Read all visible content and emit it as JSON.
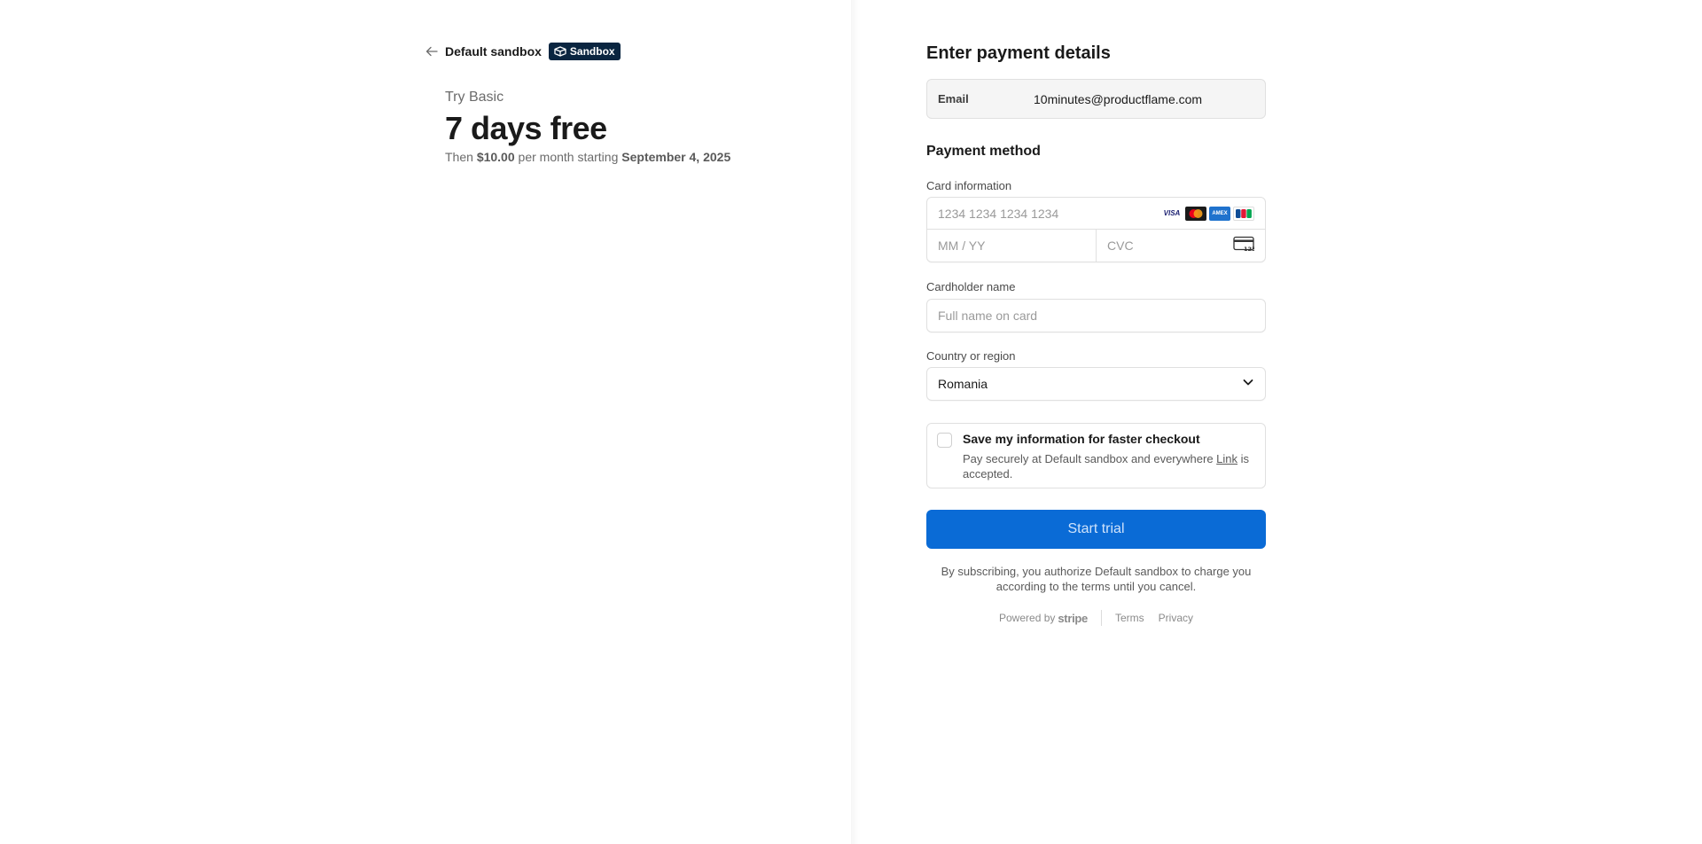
{
  "merchant": {
    "name": "Default sandbox",
    "badge": "Sandbox"
  },
  "product": {
    "name": "Try Basic",
    "trial_title": "7 days free",
    "then_prefix": "Then ",
    "price": "$10.00",
    "per": " per month starting ",
    "start_date": "September 4, 2025"
  },
  "payment": {
    "title": "Enter payment details",
    "email_label": "Email",
    "email_value": "10minutes@productflame.com",
    "method_title": "Payment method",
    "card_label": "Card information",
    "card_number_placeholder": "1234 1234 1234 1234",
    "expiry_placeholder": "MM / YY",
    "cvc_placeholder": "CVC",
    "cardholder_label": "Cardholder name",
    "cardholder_placeholder": "Full name on card",
    "country_label": "Country or region",
    "country_value": "Romania",
    "save_title": "Save my information for faster checkout",
    "save_desc_before": "Pay securely at Default sandbox and everywhere ",
    "save_desc_link": "Link",
    "save_desc_after": " is accepted.",
    "submit_label": "Start trial",
    "legal_text": "By subscribing, you authorize Default sandbox to charge you according to the terms until you cancel."
  },
  "card_brands": [
    "VISA",
    "mastercard",
    "AMEX",
    "JCB"
  ],
  "footer": {
    "powered_by": "Powered by",
    "stripe": "stripe",
    "terms": "Terms",
    "privacy": "Privacy"
  },
  "colors": {
    "primary_button": "#0a6bd6",
    "badge_bg": "#0a2540"
  },
  "icons": {
    "back": "arrow-left-icon",
    "badge": "sandbox-box-icon",
    "cvc": "cvc-card-icon",
    "select": "chevron-down-icon"
  }
}
